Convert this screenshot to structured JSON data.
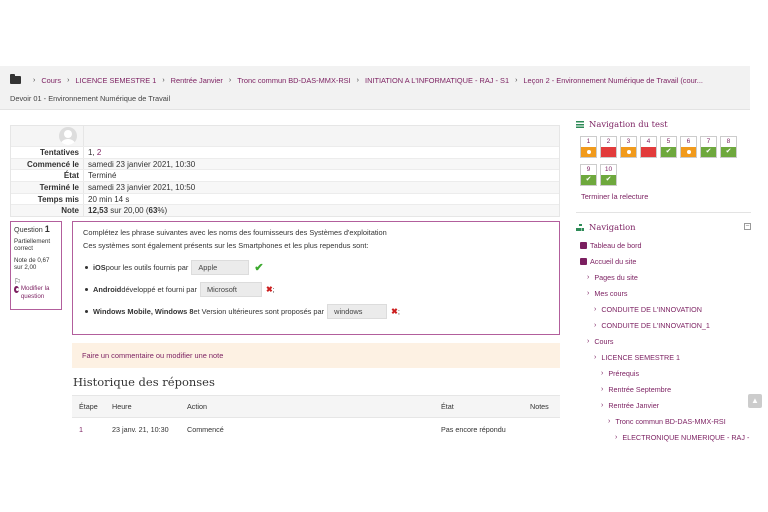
{
  "breadcrumb": {
    "items": [
      "Cours",
      "LICENCE SEMESTRE 1",
      "Rentrée Janvier",
      "Tronc commun BD-DAS-MMX-RSI",
      "INITIATION A L'INFORMATIQUE - RAJ - S1",
      "Leçon 2 - Environnement Numérique de Travail (cour..."
    ],
    "current": "Devoir 01 - Environnement Numérique de Travail"
  },
  "summary": {
    "attempts_label": "Tentatives",
    "attempts_1": "1",
    "attempts_sep": ", ",
    "attempts_2": "2",
    "started_label": "Commencé le",
    "started_value": "samedi 23 janvier 2021, 10:30",
    "state_label": "État",
    "state_value": "Terminé",
    "finished_label": "Terminé le",
    "finished_value": "samedi 23 janvier 2021, 10:50",
    "time_label": "Temps mis",
    "time_value": "20 min 14 s",
    "grade_label": "Note",
    "grade_value": "12,53",
    "grade_rest": " sur 20,00 (",
    "grade_pct": "63",
    "grade_end": "%)"
  },
  "question_info": {
    "qno_label": "Question ",
    "qno": "1",
    "status": "Partiellement correct",
    "mark": "Note de 0,67 sur 2,00",
    "flag": "⚐",
    "edit": "Modifier la question"
  },
  "question": {
    "intro": "Complétez les phrase suivantes avec les noms des fournisseurs des Systèmes d'exploitation",
    "sub": "Ces systèmes sont également présents sur les Smartphones et les plus rependus sont:",
    "item1_bold": "iOS",
    "item1_text": " pour les outils fournis par",
    "item1_answer": "Apple",
    "item1_mark": "✔",
    "item2_bold": "Android",
    "item2_text": " développé et fourni par",
    "item2_answer": "Microsoft",
    "item2_mark": "✖",
    "item2_end": ";",
    "item3_bold": "Windows Mobile, Windows 8",
    "item3_text": " et Version ultérieures sont proposés par",
    "item3_answer": "windows",
    "item3_mark": "✖",
    "item3_end": ";"
  },
  "comment_link": "Faire un commentaire ou modifier une note",
  "history": {
    "title": "Historique des réponses",
    "headers": [
      "Étape",
      "Heure",
      "Action",
      "État",
      "Notes"
    ],
    "rows": [
      [
        "1",
        "23 janv. 21, 10:30",
        "Commencé",
        "Pas encore répondu",
        ""
      ]
    ]
  },
  "quiz_nav": {
    "title": "Navigation du test",
    "finish": "Terminer la relecture",
    "cells": [
      {
        "n": "1",
        "state": "orange"
      },
      {
        "n": "2",
        "state": "red"
      },
      {
        "n": "3",
        "state": "orange"
      },
      {
        "n": "4",
        "state": "red"
      },
      {
        "n": "5",
        "state": "green"
      },
      {
        "n": "6",
        "state": "orange"
      },
      {
        "n": "7",
        "state": "green"
      },
      {
        "n": "8",
        "state": "green"
      },
      {
        "n": "9",
        "state": "green"
      },
      {
        "n": "10",
        "state": "green"
      }
    ]
  },
  "navigation": {
    "title": "Navigation",
    "items": [
      {
        "label": "Tableau de bord",
        "indent": 0,
        "icon": true
      },
      {
        "label": "Accueil du site",
        "indent": 0,
        "icon": true
      },
      {
        "label": "Pages du site",
        "indent": 1
      },
      {
        "label": "Mes cours",
        "indent": 1
      },
      {
        "label": "CONDUITE DE L'INNOVATION",
        "indent": 2
      },
      {
        "label": "CONDUITE DE L'INNOVATION_1",
        "indent": 2
      },
      {
        "label": "Cours",
        "indent": 1
      },
      {
        "label": "LICENCE SEMESTRE 1",
        "indent": 2
      },
      {
        "label": "Prérequis",
        "indent": 3
      },
      {
        "label": "Rentrée Septembre",
        "indent": 3
      },
      {
        "label": "Rentrée Janvier",
        "indent": 3
      },
      {
        "label": "Tronc commun BD-DAS-MMX-RSI",
        "indent": 4
      },
      {
        "label": "ELECTRONIQUE NUMERIQUE - RAJ -",
        "indent": 5
      }
    ]
  },
  "colors": {
    "accent": "#7b1f60",
    "green": "#6ea83d",
    "red": "#e23b3b",
    "orange": "#f19a1c",
    "border": "#b25e9c"
  }
}
